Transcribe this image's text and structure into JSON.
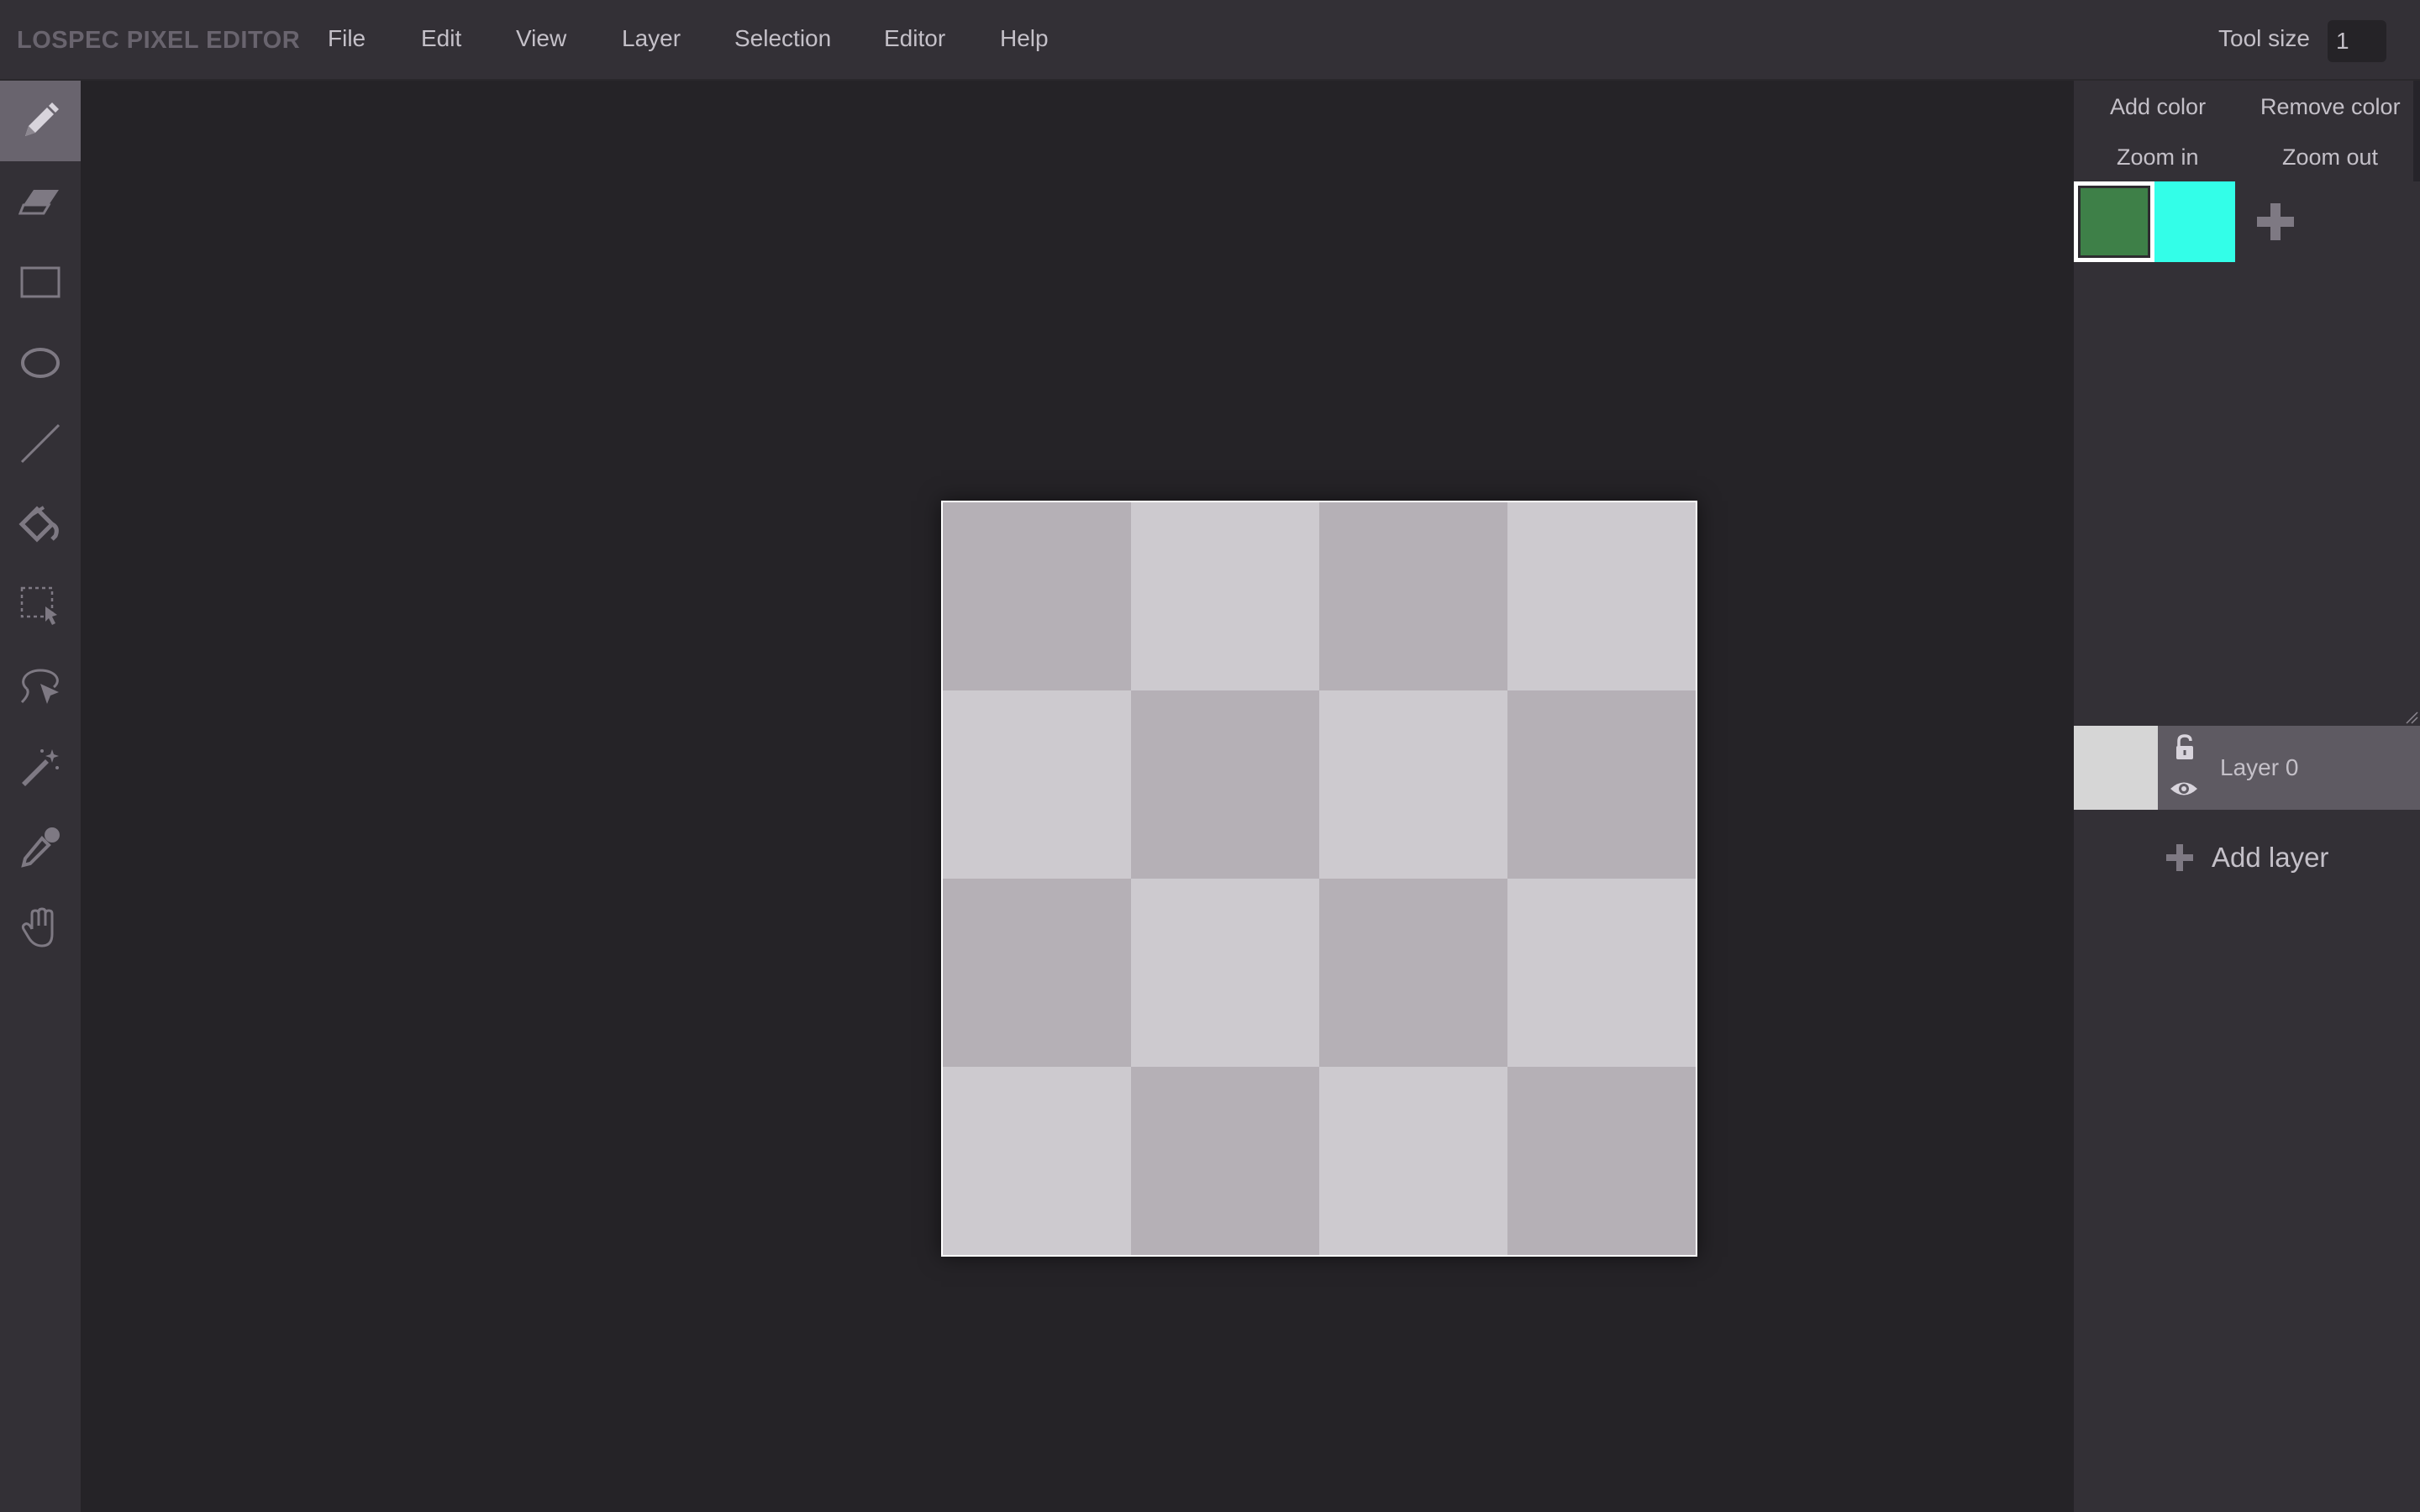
{
  "app": {
    "title": "LOSPEC PIXEL EDITOR"
  },
  "menu": {
    "items": [
      {
        "label": "File"
      },
      {
        "label": "Edit"
      },
      {
        "label": "View"
      },
      {
        "label": "Layer"
      },
      {
        "label": "Selection"
      },
      {
        "label": "Editor"
      },
      {
        "label": "Help"
      }
    ]
  },
  "tool_size": {
    "label": "Tool size",
    "value": "1"
  },
  "tools": [
    {
      "name": "pencil",
      "icon": "pencil-icon",
      "active": true
    },
    {
      "name": "eraser",
      "icon": "eraser-icon"
    },
    {
      "name": "rectangle",
      "icon": "rectangle-icon"
    },
    {
      "name": "ellipse",
      "icon": "ellipse-icon"
    },
    {
      "name": "line",
      "icon": "line-icon"
    },
    {
      "name": "fill",
      "icon": "fill-bucket-icon"
    },
    {
      "name": "rectangle-select",
      "icon": "rect-select-icon"
    },
    {
      "name": "lasso",
      "icon": "lasso-icon"
    },
    {
      "name": "magic-wand",
      "icon": "magic-wand-icon"
    },
    {
      "name": "eyedropper",
      "icon": "eyedropper-icon"
    },
    {
      "name": "pan",
      "icon": "hand-icon"
    }
  ],
  "brush_size_buttons": {
    "increase": "+",
    "decrease": "−"
  },
  "palette": {
    "add_color": "Add color",
    "remove_color": "Remove color",
    "zoom_in": "Zoom in",
    "zoom_out": "Zoom out",
    "colors": [
      "#3e8048",
      "#33fee8"
    ],
    "selected_index": 0
  },
  "canvas": {
    "checker_dark": "#b5b0b6",
    "checker_light": "#cdcacf",
    "grid": 4
  },
  "layers": [
    {
      "name": "Layer 0",
      "thumbnail_color": "#d6d6d6"
    }
  ],
  "add_layer": {
    "label": "Add layer"
  },
  "colors": {
    "background": "#252327",
    "panel": "#333036",
    "active_tool": "#69646e",
    "layer_row": "#5e5a62",
    "text": "#c4c0c8"
  }
}
